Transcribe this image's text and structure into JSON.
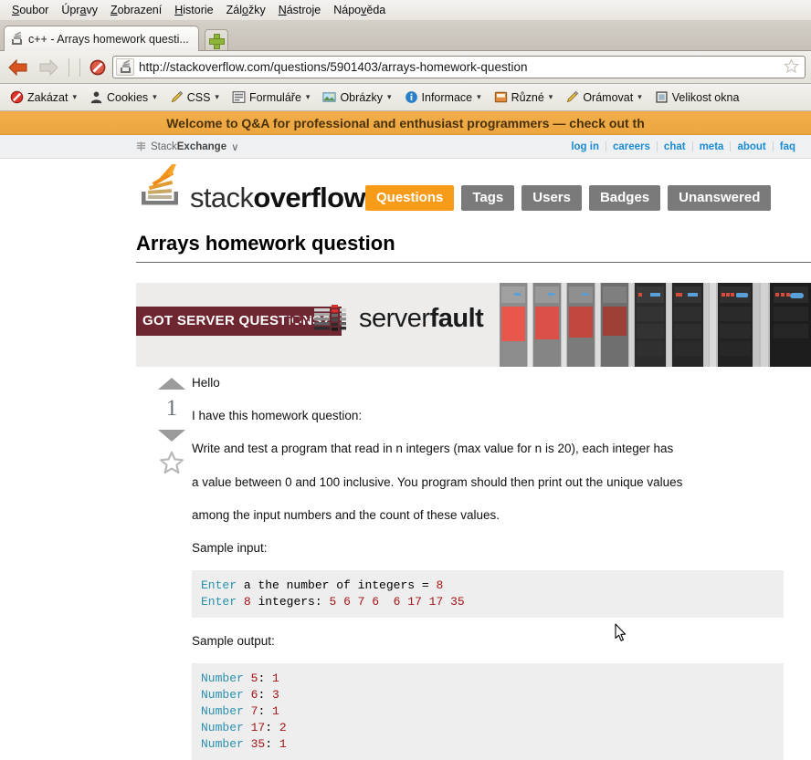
{
  "browser": {
    "menus": [
      "Soubor",
      "Úpravy",
      "Zobrazení",
      "Historie",
      "Záložky",
      "Nástroje",
      "Nápověda"
    ],
    "tab_title": "c++ - Arrays homework questi...",
    "new_tab_label": "+",
    "url": "http://stackoverflow.com/questions/5901403/arrays-homework-question",
    "devtoolbar": [
      {
        "label": "Zakázat",
        "icon": "disable-icon"
      },
      {
        "label": "Cookies",
        "icon": "user-icon"
      },
      {
        "label": "CSS",
        "icon": "pencil-icon"
      },
      {
        "label": "Formuláře",
        "icon": "form-icon"
      },
      {
        "label": "Obrázky",
        "icon": "image-icon"
      },
      {
        "label": "Informace",
        "icon": "info-icon"
      },
      {
        "label": "Různé",
        "icon": "misc-icon"
      },
      {
        "label": "Orámovat",
        "icon": "outline-icon"
      },
      {
        "label": "Velikost okna",
        "icon": "resize-icon"
      }
    ],
    "caret": "▾"
  },
  "site": {
    "promo_banner": "Welcome to Q&A for professional and enthusiast programmers — check out th",
    "stackexchange_label_prefix": "Stack",
    "stackexchange_label_bold": "Exchange",
    "stackexchange_caret": "∨",
    "top_links": [
      "log in",
      "careers",
      "chat",
      "meta",
      "about",
      "faq"
    ],
    "logo_text_light": "stack",
    "logo_text_bold": "overflow",
    "nav": [
      {
        "label": "Questions",
        "active": true
      },
      {
        "label": "Tags",
        "active": false
      },
      {
        "label": "Users",
        "active": false
      },
      {
        "label": "Badges",
        "active": false
      },
      {
        "label": "Unanswered",
        "active": false
      }
    ],
    "accent_orange": "#f79b18",
    "nav_gray": "#7a7a7a",
    "link_blue": "#1a8bd4"
  },
  "question": {
    "title": "Arrays homework question",
    "vote_count": "1",
    "paragraphs": [
      "Hello",
      "I have this homework question:",
      "Write and test a program that read in n integers (max value for n is 20), each integer has",
      "a value between 0 and 100 inclusive. You program should then print out the unique values",
      "among the input numbers and the count of these values."
    ],
    "sample_input_label": "Sample input:",
    "sample_output_label": "Sample output:",
    "code_input": [
      {
        "kw": "Enter",
        "rest": " a the number of integers = ",
        "tail_num": "8"
      },
      {
        "kw": "Enter",
        "rest": " ",
        "mid_num": "8",
        "rest2": " integers: ",
        "nums": "5 6 7 6  6 17 17 35"
      }
    ],
    "code_output_lines": [
      {
        "kw": "Number",
        "num": "5",
        "sep": ": ",
        "count": "1"
      },
      {
        "kw": "Number",
        "num": "6",
        "sep": ": ",
        "count": "3"
      },
      {
        "kw": "Number",
        "num": "7",
        "sep": ": ",
        "count": "1"
      },
      {
        "kw": "Number",
        "num": "17",
        "sep": ": ",
        "count": "2"
      },
      {
        "kw": "Number",
        "num": "35",
        "sep": ": ",
        "count": "1"
      }
    ]
  },
  "ad": {
    "headline": "GOT SERVER QUESTIONS?",
    "try": "TRY",
    "brand_light": "server",
    "brand_bold": "fault",
    "bg": "#6e2630"
  }
}
